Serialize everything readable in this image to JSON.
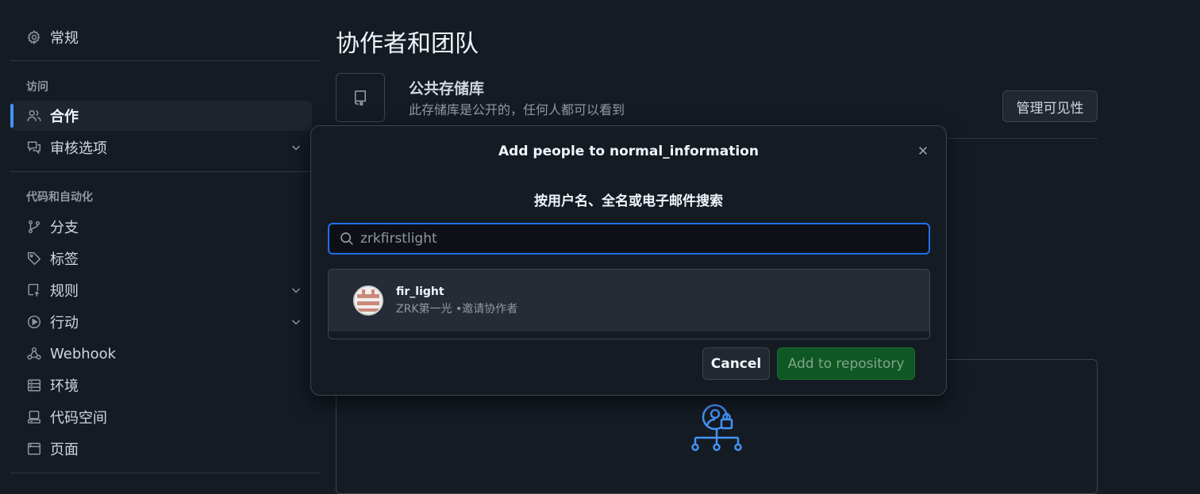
{
  "sidebar": {
    "items": [
      {
        "label": "常规",
        "icon": "gear-icon"
      },
      {
        "label": "合作",
        "icon": "people-icon"
      },
      {
        "label": "审核选项",
        "icon": "comment-discussion-icon"
      },
      {
        "label": "分支",
        "icon": "git-branch-icon"
      },
      {
        "label": "标签",
        "icon": "tag-icon"
      },
      {
        "label": "规则",
        "icon": "repo-push-icon"
      },
      {
        "label": "行动",
        "icon": "play-icon"
      },
      {
        "label": "Webhook",
        "icon": "webhook-icon"
      },
      {
        "label": "环境",
        "icon": "server-icon"
      },
      {
        "label": "代码空间",
        "icon": "codespaces-icon"
      },
      {
        "label": "页面",
        "icon": "browser-icon"
      }
    ],
    "sections": {
      "access": "访问",
      "automation": "代码和自动化"
    },
    "active_item": "合作"
  },
  "main": {
    "title": "协作者和团队",
    "visibility_title": "公共存储库",
    "visibility_desc": "此存储库是公开的，任何人都可以看到",
    "manage_label": "管理可见性"
  },
  "modal": {
    "title": "Add people to normal_information",
    "subtitle": "按用户名、全名或电子邮件搜索",
    "search_value": "zrkfirstlight",
    "result": {
      "login": "fir_light",
      "meta": "ZRK第一光 •邀请协作者"
    },
    "cancel_label": "Cancel",
    "add_label": "Add to repository"
  },
  "colors": {
    "background": "#151b23",
    "accent": "#4493f8",
    "primary_button": "#105823"
  }
}
